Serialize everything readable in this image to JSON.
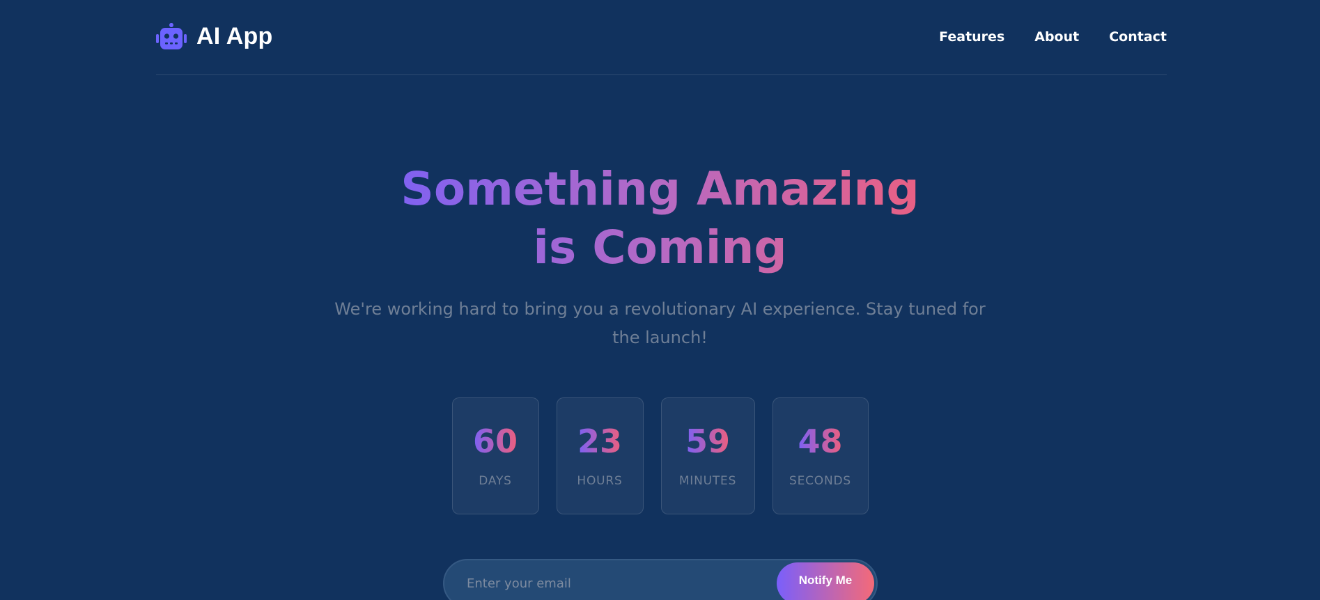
{
  "brand": {
    "icon": "robot-icon",
    "name": "AI App",
    "icon_color": "#6c63ff"
  },
  "nav": {
    "links": [
      "Features",
      "About",
      "Contact"
    ]
  },
  "hero": {
    "title": "Something Amazing is Coming",
    "subtitle": "We're working hard to bring you a revolutionary AI experience. Stay tuned for the launch!"
  },
  "countdown": [
    {
      "value": "60",
      "label": "DAYS"
    },
    {
      "value": "23",
      "label": "HOURS"
    },
    {
      "value": "59",
      "label": "MINUTES"
    },
    {
      "value": "48",
      "label": "SECONDS"
    }
  ],
  "signup": {
    "placeholder": "Enter your email",
    "value": "",
    "button_label": "Notify Me"
  },
  "colors": {
    "background": "#11325e",
    "gradient_start": "#7b61f5",
    "gradient_end": "#ee5f7d"
  }
}
